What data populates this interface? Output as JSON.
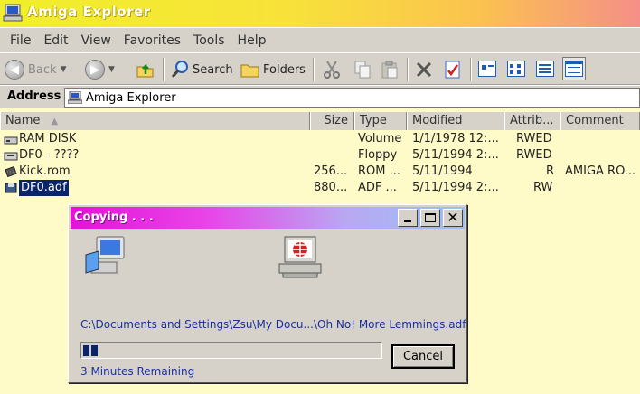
{
  "window": {
    "title": "Amiga Explorer"
  },
  "menu": [
    "File",
    "Edit",
    "View",
    "Favorites",
    "Tools",
    "Help"
  ],
  "toolbar": {
    "back_label": "Back",
    "search_label": "Search",
    "folders_label": "Folders"
  },
  "address": {
    "label": "Address",
    "value": "Amiga Explorer"
  },
  "columns": [
    "Name",
    "Size",
    "Type",
    "Modified",
    "Attrib...",
    "Comment"
  ],
  "rows": [
    {
      "name": "RAM DISK",
      "size": "",
      "type": "Volume",
      "modified": "1/1/1978 12:...",
      "attrib": "RWED",
      "comment": ""
    },
    {
      "name": "DF0 - ????",
      "size": "",
      "type": "Floppy",
      "modified": "5/11/1994 2:...",
      "attrib": "RWED",
      "comment": ""
    },
    {
      "name": "Kick.rom",
      "size": "256...",
      "type": "ROM ...",
      "modified": "5/11/1994",
      "attrib": "R",
      "comment": "AMIGA RO..."
    },
    {
      "name": "DF0.adf",
      "size": "880...",
      "type": "ADF ...",
      "modified": "5/11/1994 2:...",
      "attrib": "RW",
      "comment": ""
    }
  ],
  "dialog": {
    "title": "Copying . . .",
    "path": "C:\\Documents and Settings\\Zsu\\My Docu...\\Oh No! More Lemmings.adf",
    "remaining": "3 Minutes Remaining",
    "cancel_label": "Cancel",
    "progress_fraction": 0.06
  },
  "colors": {
    "title_gradient_start": "#f0ef2a",
    "dialog_title_gradient_start": "#e512d8",
    "background": "#fffbc8",
    "selection": "#0a246a"
  }
}
